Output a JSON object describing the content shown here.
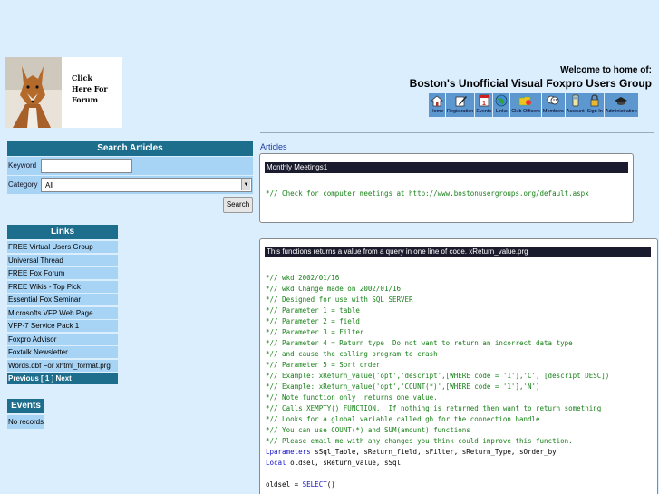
{
  "header": {
    "logo_text_lines": [
      "Click",
      "Here For",
      "Forum"
    ],
    "welcome": "Welcome to home of:",
    "site_title": "Boston's Unofficial Visual Foxpro Users Group",
    "nav": [
      {
        "label": "Home",
        "icon": "house-icon"
      },
      {
        "label": "Registration",
        "icon": "pen-icon"
      },
      {
        "label": "Events",
        "icon": "calendar-icon"
      },
      {
        "label": "Links",
        "icon": "globe-icon"
      },
      {
        "label": "Club Officers",
        "icon": "folder-icon"
      },
      {
        "label": "Members",
        "icon": "people-icon"
      },
      {
        "label": "Account",
        "icon": "phone-icon"
      },
      {
        "label": "Sign In",
        "icon": "lock-icon"
      },
      {
        "label": "Administration",
        "icon": "hat-icon"
      }
    ]
  },
  "search": {
    "title": "Search Articles",
    "keyword_label": "Keyword",
    "keyword_value": "",
    "category_label": "Category",
    "category_value": "All",
    "button": "Search"
  },
  "links": {
    "title": "Links",
    "items": [
      "FREE Virtual Users Group",
      "Universal Thread",
      "FREE Fox Forum",
      "FREE Wikis - Top Pick",
      "Essential Fox Seminar",
      "Microsofts VFP Web Page",
      "VFP-7 Service Pack 1",
      "Foxpro Advisor",
      "Foxtalk Newsletter",
      "Words.dbf For xhtml_format.prg"
    ],
    "pager": "Previous [ 1 ] Next"
  },
  "events": {
    "title": "Events",
    "empty": "No records"
  },
  "main": {
    "articles_label": "Articles",
    "article1": {
      "title": "Monthly Meetings1",
      "lines": [
        {
          "t": "",
          "c": "blk"
        },
        {
          "t": "*// Check for computer meetings at http://www.bostonusergroups.org/default.aspx",
          "c": "cmt"
        }
      ]
    },
    "article2": {
      "title": "This functions returns a value from a query in one line of code. xReturn_value.prg",
      "lines": [
        {
          "t": "",
          "c": "blk"
        },
        {
          "t": "*// wkd 2002/01/16",
          "c": "cmt"
        },
        {
          "t": "*// wkd Change made on 2002/01/16",
          "c": "cmt"
        },
        {
          "t": "*// Designed for use with SQL SERVER",
          "c": "cmt"
        },
        {
          "t": "*// Parameter 1 = table",
          "c": "cmt"
        },
        {
          "t": "*// Parameter 2 = field",
          "c": "cmt"
        },
        {
          "t": "*// Parameter 3 = Filter",
          "c": "cmt"
        },
        {
          "t": "*// Parameter 4 = Return type  Do not want to return an incorrect data type",
          "c": "cmt"
        },
        {
          "t": "*// and cause the calling program to crash",
          "c": "cmt"
        },
        {
          "t": "*// Parameter 5 = Sort order",
          "c": "cmt"
        },
        {
          "t": "*// Example: xReturn_value('opt','descript',[WHERE code = '1'],'C', [descript DESC])",
          "c": "cmt"
        },
        {
          "t": "*// Example: xReturn_value('opt','COUNT(*)',[WHERE code = '1'],'N')",
          "c": "cmt"
        },
        {
          "t": "*// Note function only  returns one value.",
          "c": "cmt"
        },
        {
          "t": "*// Calls XEMPTY() FUNCTION.  If nothing is returned then want to return something",
          "c": "cmt"
        },
        {
          "t": "*// Looks for a global variable called gh for the connection handle",
          "c": "cmt"
        },
        {
          "t": "*// You can use COUNT(*) and SUM(amount) functions",
          "c": "cmt"
        },
        {
          "t": "*// Please email me with any changes you think could improve this function.",
          "c": "cmt"
        },
        {
          "parts": [
            {
              "t": "Lparameters",
              "c": "kw"
            },
            {
              "t": " sSql_Table, sReturn_field, sFilter, sReturn_Type, sOrder_by",
              "c": "blk"
            }
          ]
        },
        {
          "parts": [
            {
              "t": "Local",
              "c": "kw"
            },
            {
              "t": " oldsel, sReturn_value, sSql",
              "c": "blk"
            }
          ]
        },
        {
          "t": "",
          "c": "blk"
        },
        {
          "parts": [
            {
              "t": "oldsel = ",
              "c": "blk"
            },
            {
              "t": "SELECT",
              "c": "kw"
            },
            {
              "t": "()",
              "c": "blk"
            }
          ]
        }
      ]
    }
  },
  "colors": {
    "page_bg": "#dbeefe",
    "panel_header": "#1d6d8d",
    "panel_row": "#a7d3f5",
    "comment": "#188018",
    "keyword": "#1212c8"
  }
}
